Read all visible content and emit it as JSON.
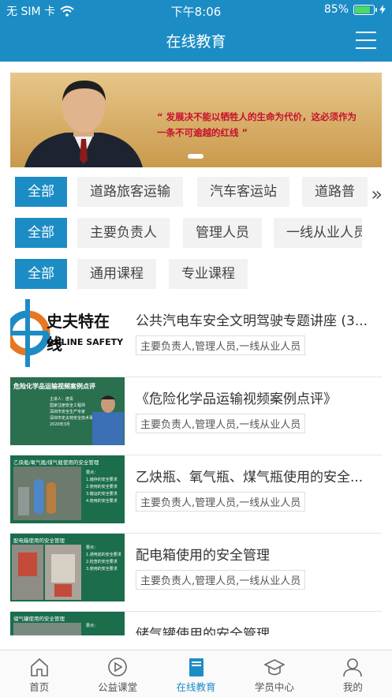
{
  "status_bar": {
    "carrier": "无 SIM 卡",
    "time": "下午8:06",
    "battery": "85%",
    "battery_level": 0.85
  },
  "header": {
    "title": "在线教育"
  },
  "banner": {
    "quote_line1": "“ 发展决不能以牺牲人的生命为代价，这必须作为",
    "quote_line2": "一条不可逾越的红线 ”"
  },
  "filters": {
    "row1": {
      "all": "全部",
      "items": [
        "道路旅客运输",
        "汽车客运站",
        "道路普"
      ]
    },
    "row2": {
      "all": "全部",
      "items": [
        "主要负责人",
        "管理人员",
        "一线从业人员"
      ]
    },
    "row3": {
      "all": "全部",
      "items": [
        "通用课程",
        "专业课程"
      ]
    }
  },
  "courses": [
    {
      "title": "公共汽电车安全文明驾驶专题讲座 (3...",
      "tag": "主要负责人,管理人员,一线从业人员",
      "thumb": {
        "line1": "史夫特在线",
        "line2": "ONLINE SAFETY"
      }
    },
    {
      "title": "《危险化学品运输视频案例点评》",
      "tag": "主要负责人,管理人员,一线从业人员",
      "thumb": {
        "line1": "危险化学品运输视频案例点评",
        "line2": "主讲人：唐青",
        "line3": "国家注册安全工程师",
        "line4": "深圳市安全生产专家",
        "line5": "深圳市史夫特安全技术事务所",
        "line6": "2020年3月"
      }
    },
    {
      "title": "乙炔瓶、氧气瓶、煤气瓶使用的安全...",
      "tag": "主要负责人,管理人员,一线从业人员",
      "thumb": {
        "line1": "乙炔瓶/氧气瓶/煤气瓶使用的安全管理",
        "line2": "要点：",
        "line3": "1.储存的安全要求",
        "line4": "2.使用的安全要求",
        "line5": "3.搬运的安全要求",
        "line6": "4.使用的安全要求"
      }
    },
    {
      "title": "配电箱使用的安全管理",
      "tag": "主要负责人,管理人员,一线从业人员",
      "thumb": {
        "line1": "配电箱使用的安全管理",
        "line2": "要点：",
        "line3": "1.通电前的安全要求",
        "line4": "2.检查的安全要求",
        "line5": "3.使用的安全要求"
      }
    },
    {
      "title": "储气罐使用的安全管理",
      "tag": "",
      "thumb": {
        "line1": "储气罐使用的安全管理",
        "line2": "要点："
      }
    }
  ],
  "bottom_nav": [
    {
      "label": "首页",
      "icon": "home-icon"
    },
    {
      "label": "公益课堂",
      "icon": "play-icon"
    },
    {
      "label": "在线教育",
      "icon": "book-icon",
      "active": true
    },
    {
      "label": "学员中心",
      "icon": "graduation-cap-icon"
    },
    {
      "label": "我的",
      "icon": "user-icon"
    }
  ],
  "colors": {
    "primary": "#1c8cc5",
    "banner_text": "#c8102e"
  }
}
